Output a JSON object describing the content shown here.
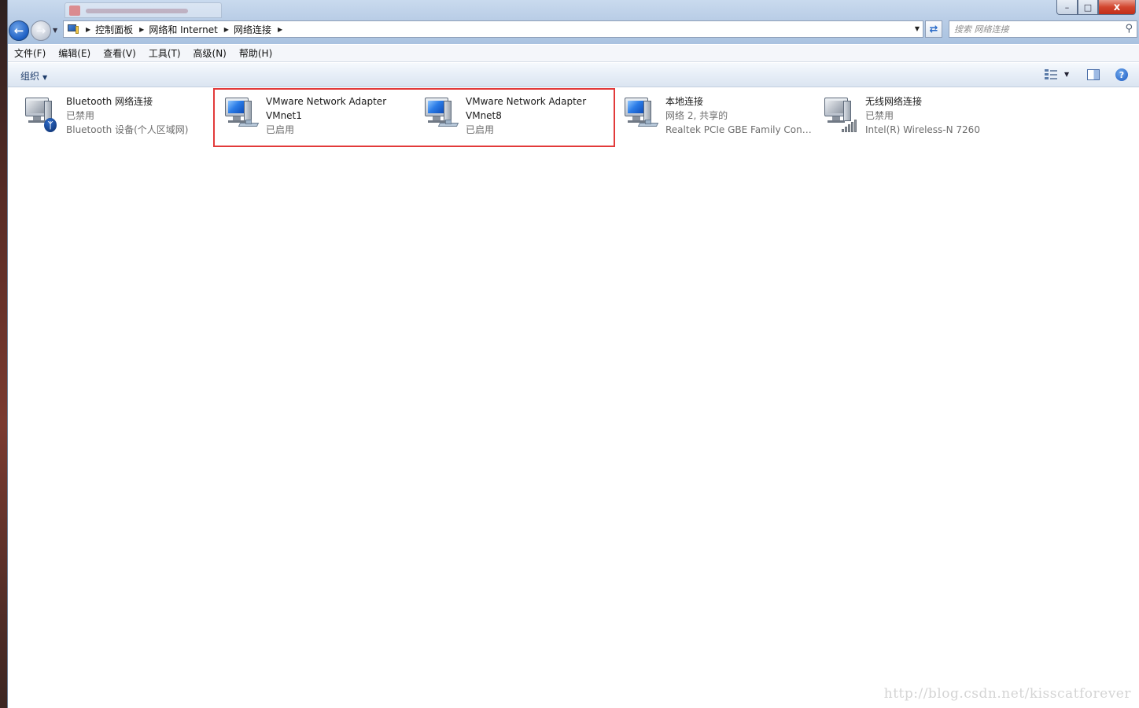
{
  "window": {
    "breadcrumb": [
      "控制面板",
      "网络和 Internet",
      "网络连接"
    ],
    "search_placeholder": "搜索 网络连接",
    "controls": {
      "minimize": "–",
      "maximize": "□",
      "close": "x"
    }
  },
  "menu": [
    "文件(F)",
    "编辑(E)",
    "查看(V)",
    "工具(T)",
    "高级(N)",
    "帮助(H)"
  ],
  "toolbar": {
    "organize_label": "组织"
  },
  "connections": [
    {
      "name": "Bluetooth 网络连接",
      "status": "已禁用",
      "device": "Bluetooth 设备(个人区域网)",
      "icon": "bluetooth-network-icon"
    },
    {
      "name": "VMware Network Adapter",
      "status": "VMnet1",
      "device": "已启用",
      "icon": "vmware-adapter-icon"
    },
    {
      "name": "VMware Network Adapter",
      "status": "VMnet8",
      "device": "已启用",
      "icon": "vmware-adapter-icon"
    },
    {
      "name": "本地连接",
      "status": "网络  2, 共享的",
      "device": "Realtek PCIe GBE Family Contr...",
      "icon": "local-area-connection-icon"
    },
    {
      "name": "无线网络连接",
      "status": "已禁用",
      "device": "Intel(R) Wireless-N 7260",
      "icon": "wireless-network-icon"
    }
  ],
  "watermark": "http://blog.csdn.net/kisscatforever",
  "colors": {
    "highlight_box": "#e23a3a",
    "titlebar": "#b9cde6",
    "close_button": "#d2462f"
  }
}
